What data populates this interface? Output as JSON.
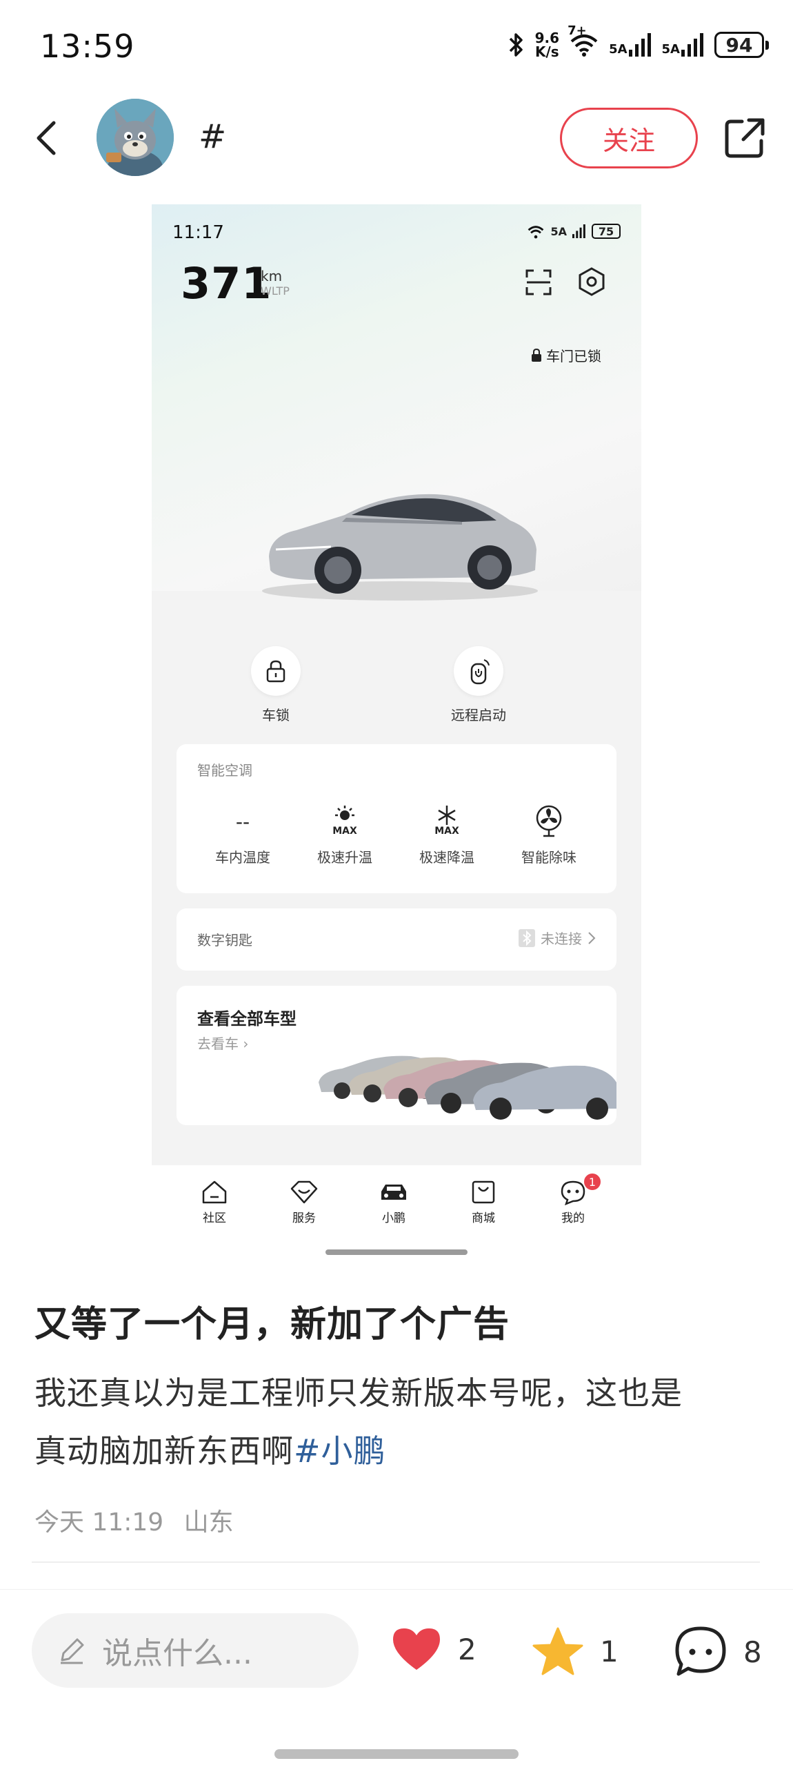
{
  "status_bar": {
    "time": "13:59",
    "net_speed_value": "9.6",
    "net_speed_unit": "K/s",
    "wifi_label": "7+",
    "signal_1": "5A",
    "signal_2": "5A",
    "battery": "94"
  },
  "header": {
    "tag": "#",
    "follow_label": "关注"
  },
  "embedded_app": {
    "time": "11:17",
    "battery": "75",
    "signal": "5A",
    "range_value": "371",
    "range_unit": "km",
    "range_standard": "WLTP",
    "door_status": "车门已锁",
    "quick_actions": [
      {
        "label": "车锁",
        "icon": "lock-icon"
      },
      {
        "label": "远程启动",
        "icon": "power-icon"
      }
    ],
    "ac": {
      "title": "智能空调",
      "items": [
        {
          "label": "车内温度",
          "value": "--"
        },
        {
          "label": "极速升温",
          "icon_text": "MAX"
        },
        {
          "label": "极速降温",
          "icon_text": "MAX"
        },
        {
          "label": "智能除味"
        }
      ]
    },
    "digital_key": {
      "label": "数字钥匙",
      "status": "未连接"
    },
    "models": {
      "title": "查看全部车型",
      "link": "去看车"
    },
    "nav": [
      {
        "label": "社区"
      },
      {
        "label": "服务"
      },
      {
        "label": "小鹏"
      },
      {
        "label": "商城"
      },
      {
        "label": "我的",
        "badge": "1"
      }
    ]
  },
  "post": {
    "title": "又等了一个月，新加了个广告",
    "body_line1": "我还真以为是工程师只发新版本号呢，这也是",
    "body_line2": "真动脑加新东西啊",
    "hashtag": "#小鹏",
    "time": "今天 11:19",
    "location": "山东"
  },
  "bottom_bar": {
    "comment_placeholder": "说点什么...",
    "likes": "2",
    "favorites": "1",
    "comments": "8"
  },
  "colors": {
    "accent": "#e8424d",
    "hashtag": "#2f5f9a",
    "star": "#f7b731"
  }
}
